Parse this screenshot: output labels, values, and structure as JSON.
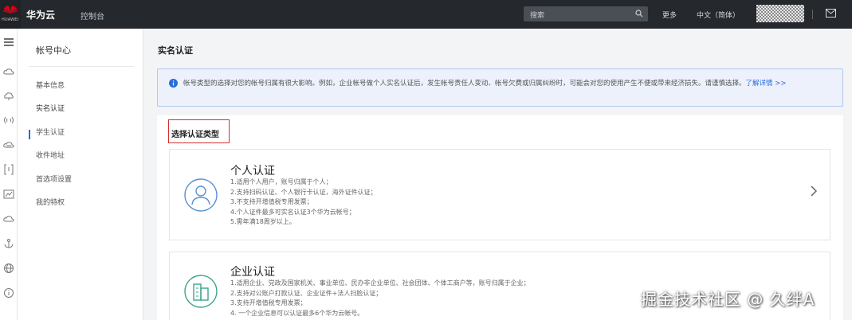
{
  "topbar": {
    "logo_sub": "HUAWEI",
    "brand": "华为云",
    "console": "控制台",
    "search_placeholder": "搜索",
    "more": "更多",
    "language": "中文（简体）"
  },
  "nav": {
    "title": "帐号中心",
    "items": [
      {
        "label": "基本信息"
      },
      {
        "label": "实名认证"
      },
      {
        "label": "学生认证"
      },
      {
        "label": "收件地址"
      },
      {
        "label": "首选项设置"
      },
      {
        "label": "我的特权"
      }
    ]
  },
  "main": {
    "page_title": "实名认证",
    "notice_text": "帐号类型的选择对您的帐号归属有很大影响。例如，企业帐号做个人实名认证后，发生帐号责任人变动、帐号欠费或归属纠纷时，可能会对您的使用产生不便或带来经济损失。请谨慎选择。",
    "notice_link": "了解详情 >>",
    "section_title": "选择认证类型",
    "options": [
      {
        "title": "个人认证",
        "lines": [
          "1.适用个人用户，账号归属于个人；",
          "2.支持扫码认证、个人银行卡认证，海外证件认证；",
          "3.不支持开增值税专用发票；",
          "4.个人证件最多可实名认证3个华为云帐号；",
          "5.需年满18周岁以上。"
        ]
      },
      {
        "title": "企业认证",
        "lines": [
          "1.适用企业、党政及国家机关、事业单位、民办非企业单位、社会团体、个体工商户等，账号归属于企业；",
          "2.支持对公账户打款认证、企业证件+法人扫脸认证；",
          "3.支持开增值税专用发票；",
          "4. 一个企业信息可以认证最多6个华为云帐号。"
        ]
      }
    ]
  },
  "watermark": "掘金技术社区 @ 久绊A",
  "colors": {
    "topbar": "#25282d",
    "accent": "#2b6cd9",
    "highlight_border": "#d32f2f",
    "notice_bg": "#ecf1fb"
  }
}
